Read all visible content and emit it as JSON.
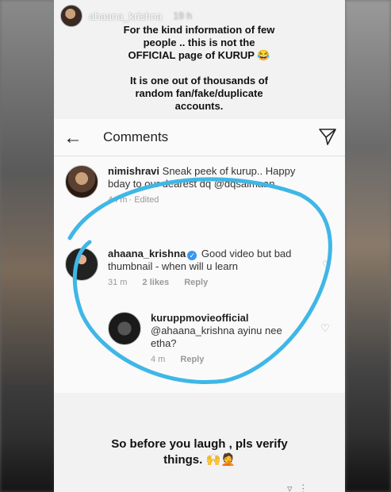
{
  "story": {
    "username": "ahaana_krishna",
    "time": "19 h"
  },
  "notice": {
    "line1": "For the kind information of few",
    "line2": "people .. this is not the",
    "line3": "OFFICIAL page of KURUP 😂",
    "line4": "It is one out of thousands of",
    "line5": "random fan/fake/duplicate",
    "line6": "accounts."
  },
  "screenshot": {
    "title": "Comments",
    "back_icon": "arrow-left-icon",
    "send_icon": "send-icon",
    "comments": [
      {
        "username": "nimishravi",
        "text": "Sneak peek of kurup.. Happy bday to our dearest dq @dqsalmaan",
        "time": "44 m",
        "extra": "Edited"
      },
      {
        "username": "ahaana_krishna",
        "verified": true,
        "text": "Good video but bad thumbnail - when will u learn",
        "time": "31 m",
        "likes": "2 likes",
        "reply": "Reply"
      },
      {
        "username": "kuruppmovieofficial",
        "text": "@ahaana_krishna ayinu nee etha?",
        "time": "4 m",
        "reply": "Reply"
      }
    ]
  },
  "footer": {
    "line1": "So before you laugh , pls verify",
    "line2": "things. 🙌🤦"
  },
  "colors": {
    "highlight": "#3fb7e6",
    "verified": "#3897f0"
  }
}
